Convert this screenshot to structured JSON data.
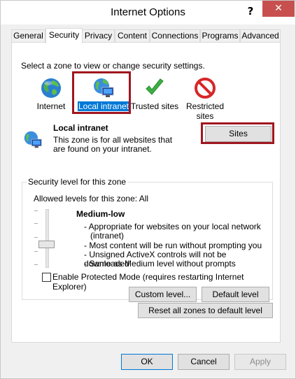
{
  "window": {
    "title": "Internet Options",
    "help_glyph": "?",
    "close_glyph": "✕"
  },
  "tabs": [
    {
      "label": "General"
    },
    {
      "label": "Security",
      "active": true
    },
    {
      "label": "Privacy"
    },
    {
      "label": "Content"
    },
    {
      "label": "Connections"
    },
    {
      "label": "Programs"
    },
    {
      "label": "Advanced"
    }
  ],
  "security": {
    "instruction": "Select a zone to view or change security settings.",
    "zones": [
      {
        "label": "Internet",
        "icon": "globe-icon"
      },
      {
        "label": "Local intranet",
        "icon": "intranet-icon",
        "selected": true
      },
      {
        "label": "Trusted sites",
        "icon": "checkmark-icon"
      },
      {
        "label": "Restricted sites",
        "icon": "restricted-icon"
      }
    ],
    "selected_zone": {
      "name": "Local intranet",
      "description": "This zone is for all websites that are found on your intranet.",
      "sites_button": "Sites"
    },
    "level": {
      "group_title": "Security level for this zone",
      "allowed": "Allowed levels for this zone: All",
      "name": "Medium-low",
      "bullets": [
        "- Appropriate for websites on your local network (intranet)",
        "- Most content will be run without prompting you",
        "- Unsigned ActiveX controls will not be downloaded",
        "- Same as Medium level without prompts"
      ],
      "protected_mode_label": "Enable Protected Mode (requires restarting Internet Explorer)",
      "protected_mode_checked": false,
      "custom_button": "Custom level...",
      "default_button": "Default level"
    },
    "reset_button": "Reset all zones to default level"
  },
  "footer": {
    "ok": "OK",
    "cancel": "Cancel",
    "apply": "Apply"
  },
  "colors": {
    "selection": "#0078d7",
    "highlight_box": "#a0161f",
    "close_button": "#c7504f"
  }
}
